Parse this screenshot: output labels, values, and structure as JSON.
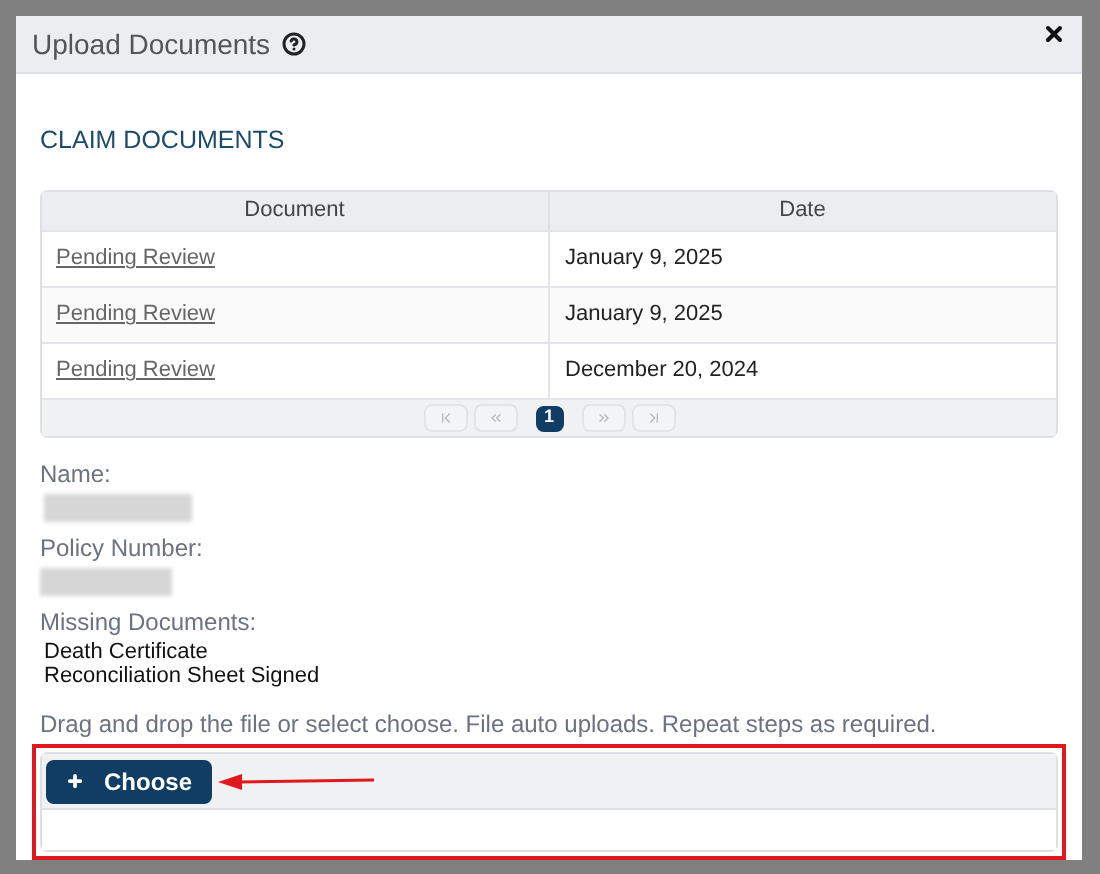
{
  "dialog": {
    "title": "Upload Documents",
    "section_title": "CLAIM DOCUMENTS"
  },
  "table": {
    "columns": [
      "Document",
      "Date"
    ],
    "rows": [
      {
        "document": "Pending Review",
        "date": "January 9, 2025"
      },
      {
        "document": "Pending Review",
        "date": "January 9, 2025"
      },
      {
        "document": "Pending Review",
        "date": "December 20, 2024"
      }
    ],
    "pages": [
      {
        "label": "1",
        "selected": true
      }
    ]
  },
  "fields": [
    {
      "label": "Name:",
      "kind": "redacted"
    },
    {
      "label": "Policy Number:",
      "kind": "redacted"
    }
  ],
  "missing": {
    "label": "Missing Documents:",
    "items": [
      "Death Certificate",
      "Reconciliation Sheet Signed"
    ]
  },
  "upload": {
    "hint": "Drag and drop the file or select choose. File auto uploads. Repeat steps as required.",
    "button": "Choose",
    "highlighted": true
  }
}
